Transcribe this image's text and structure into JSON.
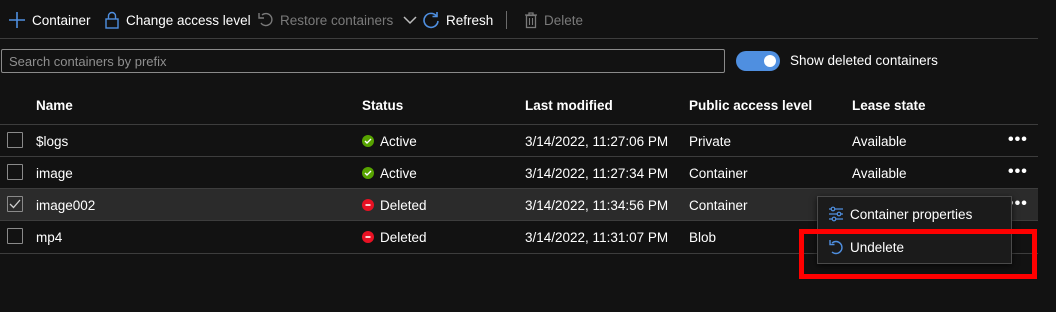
{
  "toolbar": {
    "container_label": "Container",
    "change_access_label": "Change access level",
    "restore_label": "Restore containers",
    "refresh_label": "Refresh",
    "delete_label": "Delete"
  },
  "search": {
    "placeholder": "Search containers by prefix",
    "value": ""
  },
  "toggle": {
    "label": "Show deleted containers",
    "on": true
  },
  "table": {
    "columns": [
      "Name",
      "Status",
      "Last modified",
      "Public access level",
      "Lease state"
    ],
    "rows": [
      {
        "name": "$logs",
        "status": "Active",
        "last_modified": "3/14/2022, 11:27:06 PM",
        "access": "Private",
        "lease": "Available",
        "checked": false
      },
      {
        "name": "image",
        "status": "Active",
        "last_modified": "3/14/2022, 11:27:34 PM",
        "access": "Container",
        "lease": "Available",
        "checked": false
      },
      {
        "name": "image002",
        "status": "Deleted",
        "last_modified": "3/14/2022, 11:34:56 PM",
        "access": "Container",
        "lease": "",
        "checked": true
      },
      {
        "name": "mp4",
        "status": "Deleted",
        "last_modified": "3/14/2022, 11:31:07 PM",
        "access": "Blob",
        "lease": "",
        "checked": false
      }
    ],
    "more_label": "•••"
  },
  "context_menu": {
    "items": [
      {
        "label": "Container properties",
        "icon": "properties-icon"
      },
      {
        "label": "Undelete",
        "icon": "undelete-icon"
      }
    ]
  },
  "colors": {
    "background": "#121212",
    "accent": "#4f8fe0",
    "active_status": "#57a300",
    "deleted_status": "#e81123",
    "highlight": "#ff0000"
  }
}
